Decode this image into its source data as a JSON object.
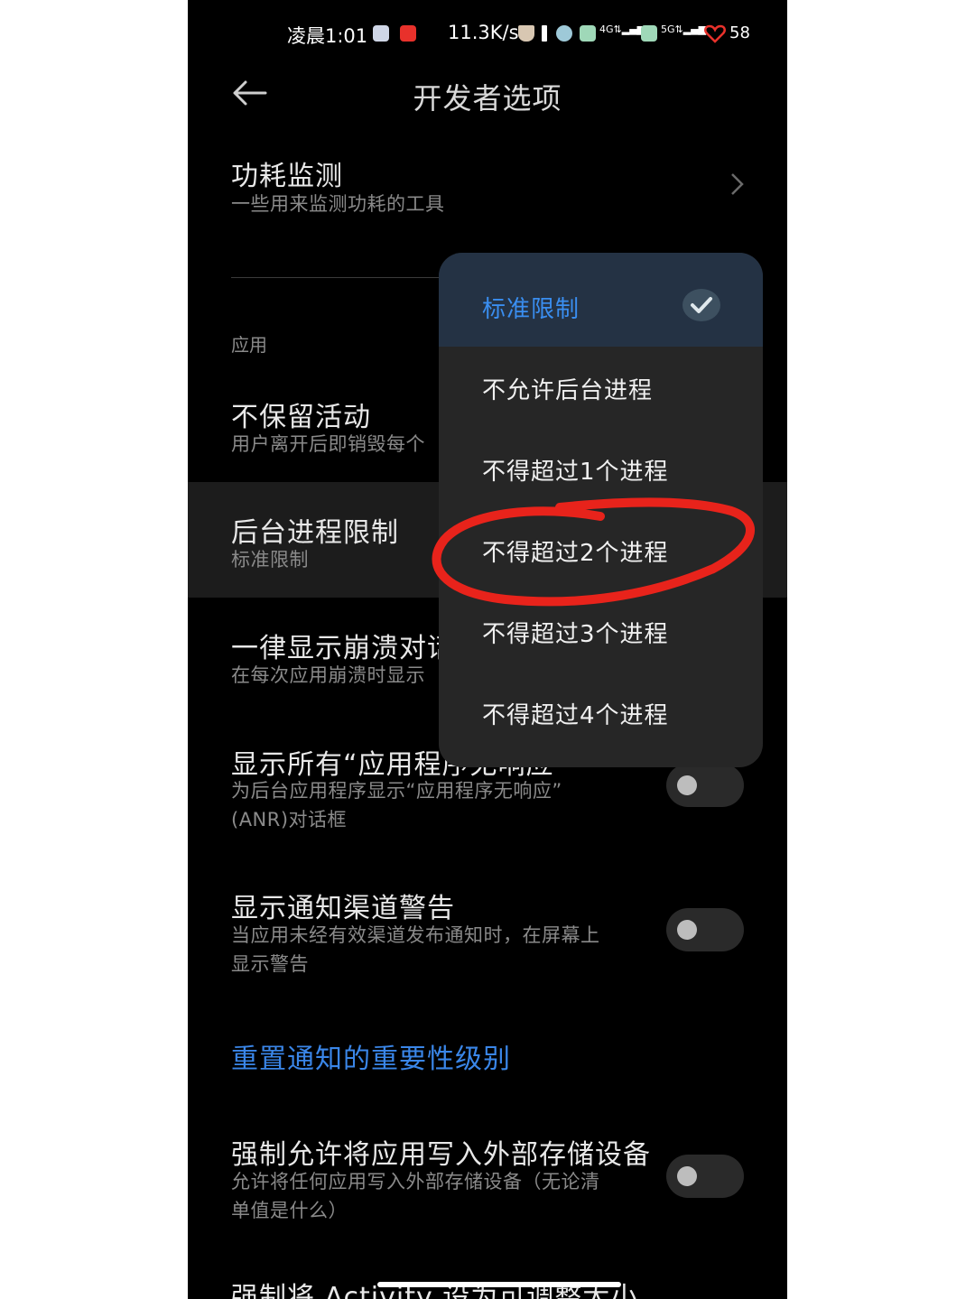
{
  "status_bar": {
    "time": "凌晨1:01",
    "net_speed": "11.3K/s",
    "battery": "58"
  },
  "header": {
    "title": "开发者选项"
  },
  "rows": [
    {
      "title": "功耗监测",
      "subtitle": "一些用来监测功耗的工具"
    },
    {
      "title": "不保留活动",
      "subtitle": "用户离开后即销毁每个"
    },
    {
      "title": "后台进程限制",
      "subtitle": "标准限制"
    },
    {
      "title": "一律显示崩溃对话",
      "subtitle": "在每次应用崩溃时显示"
    },
    {
      "title": "显示所有“应用程序无响应”",
      "subtitle_lines": [
        "为后台应用程序显示“应用程序无响应”",
        "(ANR)对话框"
      ]
    },
    {
      "title": "显示通知渠道警告",
      "subtitle_lines": [
        "当应用未经有效渠道发布通知时，在屏幕上",
        "显示警告"
      ]
    },
    {
      "title": "强制允许将应用写入外部存储设备",
      "subtitle_lines": [
        "允许将任何应用写入外部存储设备（无论清",
        "单值是什么）"
      ]
    },
    {
      "title": "强制将 Activity 设为可调整大小"
    }
  ],
  "section_label": "应用",
  "reset_link": "重置通知的重要性级别",
  "dropdown": {
    "options": [
      {
        "label": "标准限制",
        "selected": true
      },
      {
        "label": "不允许后台进程",
        "selected": false
      },
      {
        "label": "不得超过1个进程",
        "selected": false
      },
      {
        "label": "不得超过2个进程",
        "selected": false
      },
      {
        "label": "不得超过3个进程",
        "selected": false
      },
      {
        "label": "不得超过4个进程",
        "selected": false
      }
    ]
  },
  "colors": {
    "accent": "#3a86e8",
    "annotation": "#e8231b",
    "background": "#000000"
  }
}
